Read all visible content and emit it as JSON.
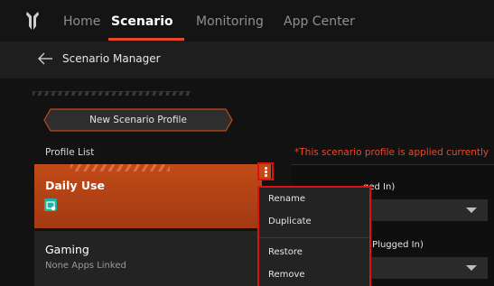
{
  "nav": {
    "logo_icon": "predator-logo",
    "tabs": [
      {
        "label": "Home",
        "active": false
      },
      {
        "label": "Scenario",
        "active": true
      },
      {
        "label": "Monitoring",
        "active": false
      },
      {
        "label": "App Center",
        "active": false
      }
    ],
    "accent": "#e8492a"
  },
  "subheader": {
    "back_icon": "arrow-left-icon",
    "title": "Scenario Manager"
  },
  "actions": {
    "new_profile": "New Scenario Profile"
  },
  "profile_list": {
    "label": "Profile List",
    "applied_note": "*This scenario profile is applied currently",
    "items": [
      {
        "name": "Daily Use",
        "subtitle": "",
        "selected": true,
        "app_icon": "app-icon"
      },
      {
        "name": "Gaming",
        "subtitle": "None Apps Linked",
        "selected": false
      }
    ]
  },
  "context_menu": {
    "items": [
      "Rename",
      "Duplicate",
      "Restore",
      "Remove"
    ]
  },
  "settings": {
    "row1_label": "ged In)",
    "row2_label": "C Plugged In)"
  },
  "colors": {
    "selected_card": "#c24a18",
    "highlight_border": "#e01010",
    "note_text": "#e8492a"
  }
}
